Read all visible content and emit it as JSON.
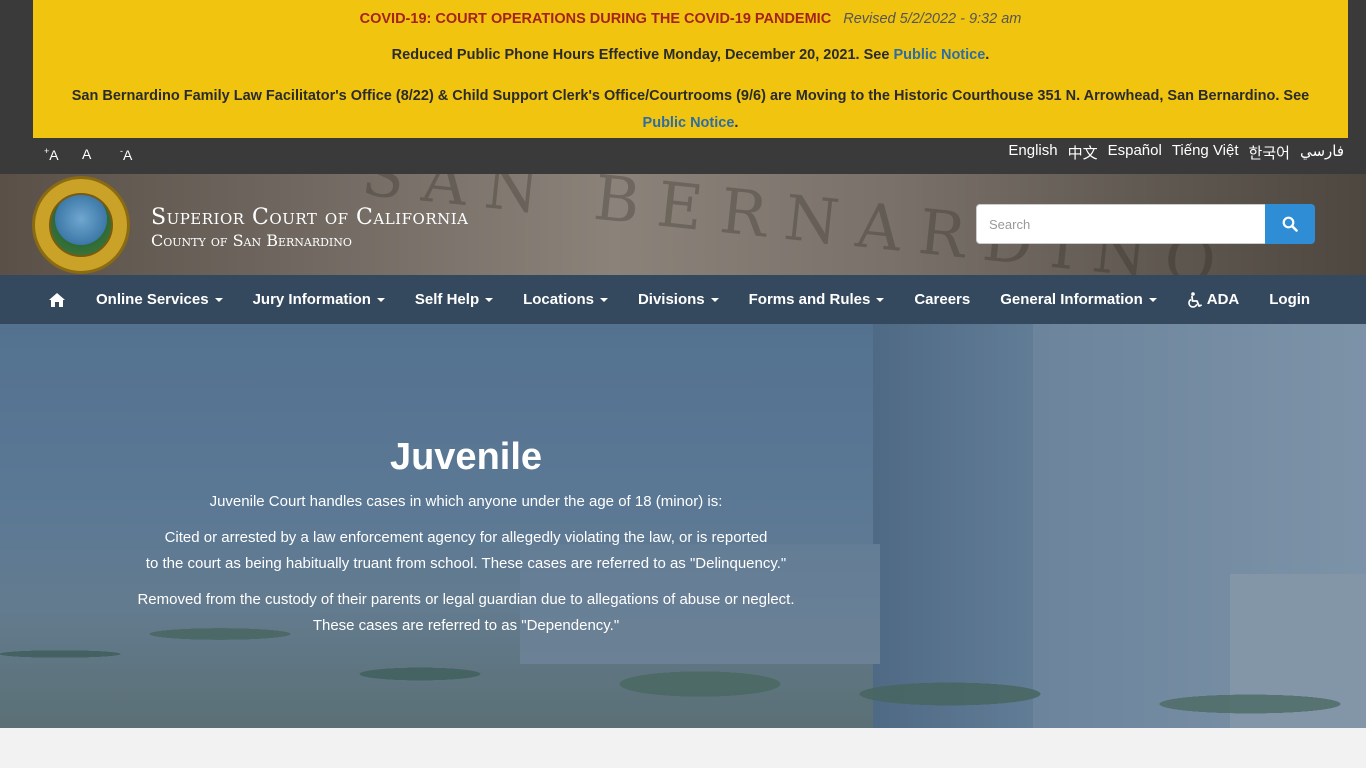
{
  "alert": {
    "covid_title": "COVID-19: COURT OPERATIONS DURING THE COVID-19 PANDEMIC",
    "revised": "Revised 5/2/2022 - 9:32 am",
    "phone_text": "Reduced Public Phone Hours Effective Monday, December 20, 2021. See ",
    "phone_link": "Public Notice",
    "move_text": "San Bernardino Family Law Facilitator's Office (8/22) & Child Support Clerk's Office/Courtrooms (9/6) are Moving to the Historic Courthouse 351 N. Arrowhead, San Bernardino. See ",
    "move_link": "Public Notice",
    "period": "."
  },
  "font_controls": {
    "increase": "A",
    "normal": "A",
    "decrease": "A"
  },
  "languages": [
    "English",
    "中文",
    "Español",
    "Tiếng Việt",
    "한국어",
    "فارسي"
  ],
  "header": {
    "title": "Superior Court of California",
    "subtitle": "County of San Bernardino",
    "search_placeholder": "Search"
  },
  "nav": {
    "items": [
      {
        "label": "Online Services",
        "dropdown": true
      },
      {
        "label": "Jury Information",
        "dropdown": true
      },
      {
        "label": "Self Help",
        "dropdown": true
      },
      {
        "label": "Locations",
        "dropdown": true
      },
      {
        "label": "Divisions",
        "dropdown": true
      },
      {
        "label": "Forms and Rules",
        "dropdown": true
      },
      {
        "label": "Careers",
        "dropdown": false
      },
      {
        "label": "General Information",
        "dropdown": true
      }
    ],
    "ada": "ADA",
    "login": "Login"
  },
  "hero": {
    "title": "Juvenile",
    "intro": "Juvenile Court handles cases in which anyone under the age of 18 (minor) is:",
    "delinquency_1": "Cited or arrested by a law enforcement agency for allegedly violating the law, or is reported",
    "delinquency_2": "to the court as being habitually truant from school. These cases are referred to as \"Delinquency.\"",
    "dependency_1": "Removed from the custody of their parents or legal guardian due to allegations of abuse or neglect.",
    "dependency_2": "These cases are referred to as \"Dependency.\""
  },
  "colors": {
    "alert_bg": "#f1c40f",
    "alert_title": "#a4231c",
    "link": "#2e6da4",
    "nav_bg": "#34495e",
    "search_btn": "#2f8dd6"
  }
}
